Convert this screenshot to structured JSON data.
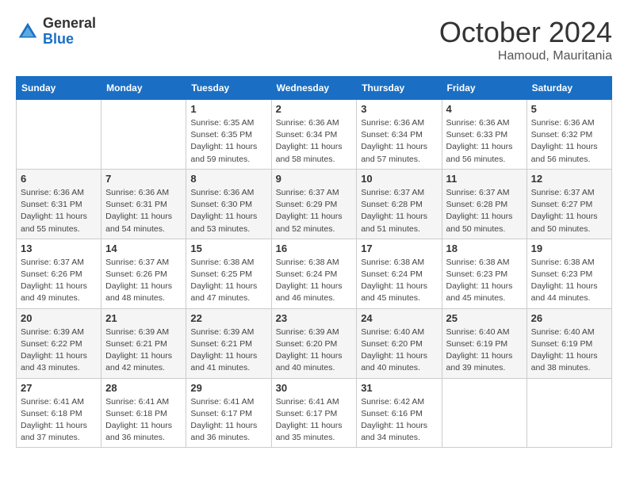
{
  "header": {
    "logo_general": "General",
    "logo_blue": "Blue",
    "month_title": "October 2024",
    "location": "Hamoud, Mauritania"
  },
  "days_of_week": [
    "Sunday",
    "Monday",
    "Tuesday",
    "Wednesday",
    "Thursday",
    "Friday",
    "Saturday"
  ],
  "weeks": [
    [
      {
        "day": "",
        "info": ""
      },
      {
        "day": "",
        "info": ""
      },
      {
        "day": "1",
        "info": "Sunrise: 6:35 AM\nSunset: 6:35 PM\nDaylight: 11 hours and 59 minutes."
      },
      {
        "day": "2",
        "info": "Sunrise: 6:36 AM\nSunset: 6:34 PM\nDaylight: 11 hours and 58 minutes."
      },
      {
        "day": "3",
        "info": "Sunrise: 6:36 AM\nSunset: 6:34 PM\nDaylight: 11 hours and 57 minutes."
      },
      {
        "day": "4",
        "info": "Sunrise: 6:36 AM\nSunset: 6:33 PM\nDaylight: 11 hours and 56 minutes."
      },
      {
        "day": "5",
        "info": "Sunrise: 6:36 AM\nSunset: 6:32 PM\nDaylight: 11 hours and 56 minutes."
      }
    ],
    [
      {
        "day": "6",
        "info": "Sunrise: 6:36 AM\nSunset: 6:31 PM\nDaylight: 11 hours and 55 minutes."
      },
      {
        "day": "7",
        "info": "Sunrise: 6:36 AM\nSunset: 6:31 PM\nDaylight: 11 hours and 54 minutes."
      },
      {
        "day": "8",
        "info": "Sunrise: 6:36 AM\nSunset: 6:30 PM\nDaylight: 11 hours and 53 minutes."
      },
      {
        "day": "9",
        "info": "Sunrise: 6:37 AM\nSunset: 6:29 PM\nDaylight: 11 hours and 52 minutes."
      },
      {
        "day": "10",
        "info": "Sunrise: 6:37 AM\nSunset: 6:28 PM\nDaylight: 11 hours and 51 minutes."
      },
      {
        "day": "11",
        "info": "Sunrise: 6:37 AM\nSunset: 6:28 PM\nDaylight: 11 hours and 50 minutes."
      },
      {
        "day": "12",
        "info": "Sunrise: 6:37 AM\nSunset: 6:27 PM\nDaylight: 11 hours and 50 minutes."
      }
    ],
    [
      {
        "day": "13",
        "info": "Sunrise: 6:37 AM\nSunset: 6:26 PM\nDaylight: 11 hours and 49 minutes."
      },
      {
        "day": "14",
        "info": "Sunrise: 6:37 AM\nSunset: 6:26 PM\nDaylight: 11 hours and 48 minutes."
      },
      {
        "day": "15",
        "info": "Sunrise: 6:38 AM\nSunset: 6:25 PM\nDaylight: 11 hours and 47 minutes."
      },
      {
        "day": "16",
        "info": "Sunrise: 6:38 AM\nSunset: 6:24 PM\nDaylight: 11 hours and 46 minutes."
      },
      {
        "day": "17",
        "info": "Sunrise: 6:38 AM\nSunset: 6:24 PM\nDaylight: 11 hours and 45 minutes."
      },
      {
        "day": "18",
        "info": "Sunrise: 6:38 AM\nSunset: 6:23 PM\nDaylight: 11 hours and 45 minutes."
      },
      {
        "day": "19",
        "info": "Sunrise: 6:38 AM\nSunset: 6:23 PM\nDaylight: 11 hours and 44 minutes."
      }
    ],
    [
      {
        "day": "20",
        "info": "Sunrise: 6:39 AM\nSunset: 6:22 PM\nDaylight: 11 hours and 43 minutes."
      },
      {
        "day": "21",
        "info": "Sunrise: 6:39 AM\nSunset: 6:21 PM\nDaylight: 11 hours and 42 minutes."
      },
      {
        "day": "22",
        "info": "Sunrise: 6:39 AM\nSunset: 6:21 PM\nDaylight: 11 hours and 41 minutes."
      },
      {
        "day": "23",
        "info": "Sunrise: 6:39 AM\nSunset: 6:20 PM\nDaylight: 11 hours and 40 minutes."
      },
      {
        "day": "24",
        "info": "Sunrise: 6:40 AM\nSunset: 6:20 PM\nDaylight: 11 hours and 40 minutes."
      },
      {
        "day": "25",
        "info": "Sunrise: 6:40 AM\nSunset: 6:19 PM\nDaylight: 11 hours and 39 minutes."
      },
      {
        "day": "26",
        "info": "Sunrise: 6:40 AM\nSunset: 6:19 PM\nDaylight: 11 hours and 38 minutes."
      }
    ],
    [
      {
        "day": "27",
        "info": "Sunrise: 6:41 AM\nSunset: 6:18 PM\nDaylight: 11 hours and 37 minutes."
      },
      {
        "day": "28",
        "info": "Sunrise: 6:41 AM\nSunset: 6:18 PM\nDaylight: 11 hours and 36 minutes."
      },
      {
        "day": "29",
        "info": "Sunrise: 6:41 AM\nSunset: 6:17 PM\nDaylight: 11 hours and 36 minutes."
      },
      {
        "day": "30",
        "info": "Sunrise: 6:41 AM\nSunset: 6:17 PM\nDaylight: 11 hours and 35 minutes."
      },
      {
        "day": "31",
        "info": "Sunrise: 6:42 AM\nSunset: 6:16 PM\nDaylight: 11 hours and 34 minutes."
      },
      {
        "day": "",
        "info": ""
      },
      {
        "day": "",
        "info": ""
      }
    ]
  ]
}
